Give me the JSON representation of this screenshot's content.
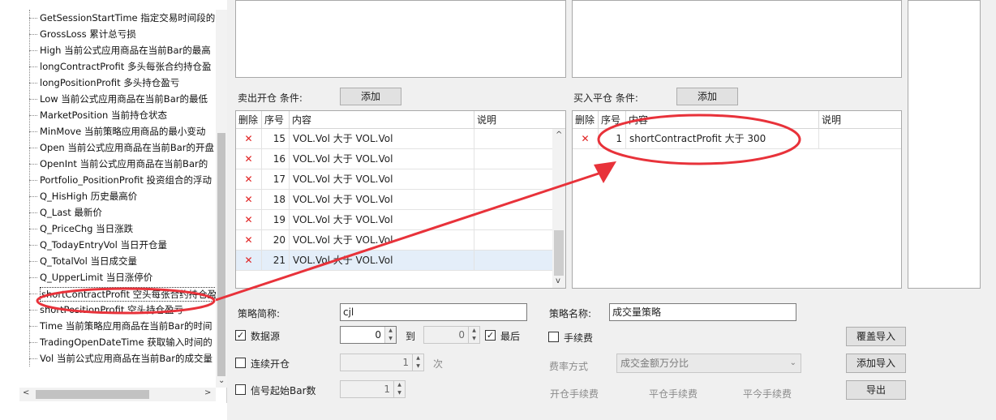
{
  "tree": {
    "items": [
      "GetSessionStartTime 指定交易时间段的",
      "GrossLoss 累计总亏损",
      "High 当前公式应用商品在当前Bar的最高",
      "longContractProfit 多头每张合约持仓盈",
      "longPositionProfit 多头持仓盈亏",
      "Low 当前公式应用商品在当前Bar的最低",
      "MarketPosition 当前持仓状态",
      "MinMove 当前策略应用商品的最小变动",
      "Open 当前公式应用商品在当前Bar的开盘",
      "OpenInt 当前公式应用商品在当前Bar的",
      "Portfolio_PositionProfit 投资组合的浮动",
      "Q_HisHigh 历史最高价",
      "Q_Last 最新价",
      "Q_PriceChg 当日涨跌",
      "Q_TodayEntryVol 当日开仓量",
      "Q_TotalVol 当日成交量",
      "Q_UpperLimit 当日涨停价",
      "shortContractProfit 空头每张合约持仓盈",
      "shortPositionProfit 空头持仓盈亏",
      "Time 当前策略应用商品在当前Bar的时间",
      "TradingOpenDateTime 获取输入时间的",
      "Vol 当前公式应用商品在当前Bar的成交量"
    ],
    "selected_index": 17
  },
  "sell_open": {
    "label": "卖出开仓 条件:",
    "add_label": "添加",
    "headers": [
      "删除",
      "序号",
      "内容",
      "说明"
    ],
    "rows": [
      {
        "no": "15",
        "content": "VOL.Vol 大于 VOL.Vol",
        "note": ""
      },
      {
        "no": "16",
        "content": "VOL.Vol 大于 VOL.Vol",
        "note": ""
      },
      {
        "no": "17",
        "content": "VOL.Vol 大于 VOL.Vol",
        "note": ""
      },
      {
        "no": "18",
        "content": "VOL.Vol 大于 VOL.Vol",
        "note": ""
      },
      {
        "no": "19",
        "content": "VOL.Vol 大于 VOL.Vol",
        "note": ""
      },
      {
        "no": "20",
        "content": "VOL.Vol 大于 VOL.Vol",
        "note": ""
      },
      {
        "no": "21",
        "content": "VOL.Vol 大于 VOL.Vol",
        "note": ""
      }
    ],
    "selected_row": 6
  },
  "buy_close": {
    "label": "买入平仓 条件:",
    "add_label": "添加",
    "headers": [
      "删除",
      "序号",
      "内容",
      "说明"
    ],
    "rows": [
      {
        "no": "1",
        "content": "shortContractProfit 大于 300",
        "note": ""
      }
    ]
  },
  "form": {
    "abbr_label": "策略简称:",
    "abbr_value": "cjl",
    "name_label": "策略名称:",
    "name_value": "成交量策略",
    "datasource_label": "数据源",
    "ds_from": "0",
    "to_label": "到",
    "ds_to": "0",
    "latest_label": "最后",
    "fee_label": "手续费",
    "continuous_label": "连续开仓",
    "continuous_value": "1",
    "times_label": "次",
    "fee_mode_label": "费率方式",
    "fee_mode_value": "成交金额万分比",
    "signal_label": "信号起始Bar数",
    "signal_value": "1",
    "open_fee_label": "开仓手续费",
    "close_fee_label": "平仓手续费",
    "today_fee_label": "平今手续费"
  },
  "buttons": {
    "overwrite": "覆盖导入",
    "add_import": "添加导入",
    "export": "导出"
  },
  "colors": {
    "annotation_red": "#e8323a",
    "delete_red": "#e02020",
    "selection": "#e4eef9"
  }
}
